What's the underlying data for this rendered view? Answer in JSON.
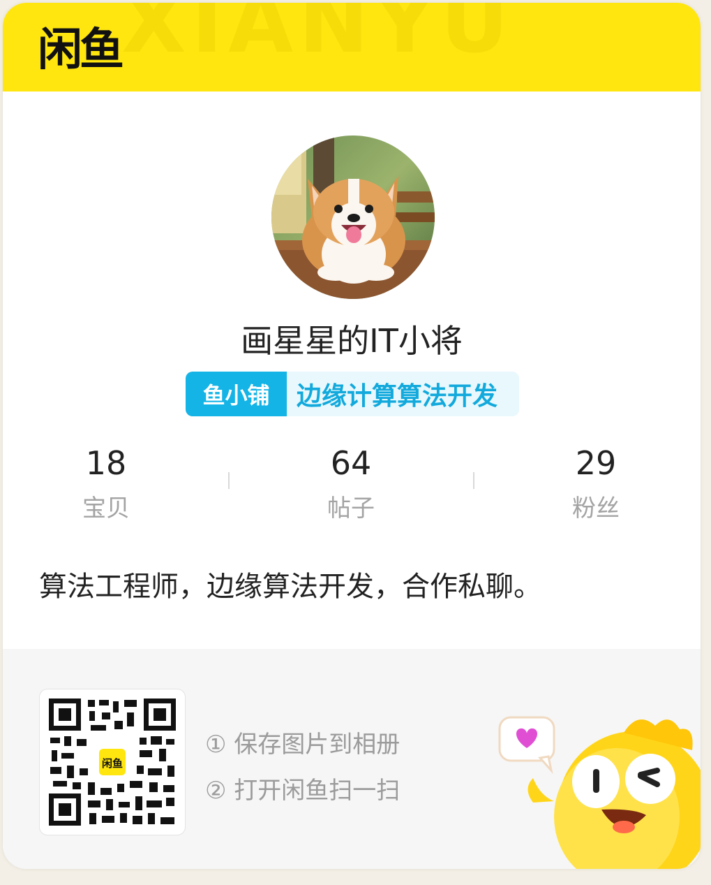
{
  "header": {
    "logo_text": "闲鱼",
    "watermark": "XIANYU",
    "color": "#ffe60f"
  },
  "profile": {
    "avatar_icon": "corgi-dog-avatar",
    "username": "画星星的IT小将",
    "shop_tag": "鱼小铺",
    "shop_name": "边缘计算算法开发",
    "shop_color": "#14b4e6"
  },
  "stats": [
    {
      "value": "18",
      "label": "宝贝"
    },
    {
      "value": "64",
      "label": "帖子"
    },
    {
      "value": "29",
      "label": "粉丝"
    }
  ],
  "bio": "算法工程师，边缘算法开发，合作私聊。",
  "footer": {
    "qr_center_logo": "闲鱼",
    "steps": [
      "① 保存图片到相册",
      "② 打开闲鱼扫一扫"
    ],
    "mascot_icon": "yellow-fish-mascot",
    "bubble_icon": "heart-bubble-icon"
  }
}
